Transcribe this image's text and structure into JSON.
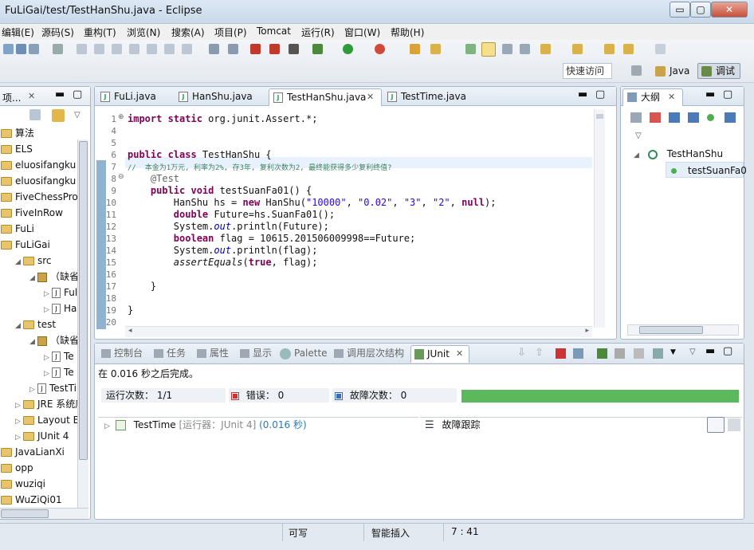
{
  "window": {
    "title": "FuLiGai/test/TestHanShu.java - Eclipse",
    "minimize": "▭",
    "maximize": "▢",
    "close": "✕"
  },
  "menu": [
    "编辑(E)",
    "源码(S)",
    "重构(T)",
    "浏览(N)",
    "搜索(A)",
    "项目(P)",
    "Tomcat",
    "运行(R)",
    "窗口(W)",
    "帮助(H)"
  ],
  "quick_access": "快速访问",
  "perspectives": {
    "java": "Java",
    "debug": "调试"
  },
  "explorer": {
    "tab": "项...",
    "items": [
      {
        "label": "算法",
        "indent": 0,
        "type": "project",
        "arrow": ""
      },
      {
        "label": "ELS",
        "indent": 0,
        "type": "project",
        "arrow": ""
      },
      {
        "label": "eluosifangku",
        "indent": 0,
        "type": "project",
        "arrow": ""
      },
      {
        "label": "eluosifangku",
        "indent": 0,
        "type": "project",
        "arrow": ""
      },
      {
        "label": "FiveChessPro",
        "indent": 0,
        "type": "project",
        "arrow": ""
      },
      {
        "label": "FiveInRow",
        "indent": 0,
        "type": "project",
        "arrow": ""
      },
      {
        "label": "FuLi",
        "indent": 0,
        "type": "project",
        "arrow": ""
      },
      {
        "label": "FuLiGai",
        "indent": 0,
        "type": "project",
        "arrow": ""
      },
      {
        "label": "src",
        "indent": 1,
        "type": "src",
        "arrow": "◢"
      },
      {
        "label": "（缺省",
        "indent": 2,
        "type": "pkg",
        "arrow": "◢"
      },
      {
        "label": "Ful",
        "indent": 3,
        "type": "java",
        "arrow": "▷"
      },
      {
        "label": "Ha",
        "indent": 3,
        "type": "java",
        "arrow": "▷"
      },
      {
        "label": "test",
        "indent": 1,
        "type": "src",
        "arrow": "◢"
      },
      {
        "label": "（缺省",
        "indent": 2,
        "type": "pkg",
        "arrow": "◢"
      },
      {
        "label": "Te",
        "indent": 3,
        "type": "java",
        "arrow": "▷"
      },
      {
        "label": "Te",
        "indent": 3,
        "type": "java",
        "arrow": "▷"
      },
      {
        "label": "TestTi",
        "indent": 2,
        "type": "java",
        "arrow": "▷"
      },
      {
        "label": "JRE 系统库",
        "indent": 1,
        "type": "lib",
        "arrow": "▷"
      },
      {
        "label": "Layout Ex",
        "indent": 1,
        "type": "lib",
        "arrow": "▷"
      },
      {
        "label": "JUnit 4",
        "indent": 1,
        "type": "lib",
        "arrow": "▷"
      },
      {
        "label": "JavaLianXi",
        "indent": 0,
        "type": "project",
        "arrow": ""
      },
      {
        "label": "opp",
        "indent": 0,
        "type": "project",
        "arrow": ""
      },
      {
        "label": "wuziqi",
        "indent": 0,
        "type": "project",
        "arrow": ""
      },
      {
        "label": "WuZiQi01",
        "indent": 0,
        "type": "project",
        "arrow": ""
      }
    ]
  },
  "editor": {
    "tabs": [
      {
        "label": "FuLi.java",
        "active": false
      },
      {
        "label": "HanShu.java",
        "active": false
      },
      {
        "label": "TestHanShu.java",
        "active": true
      },
      {
        "label": "TestTime.java",
        "active": false
      }
    ],
    "lines": [
      {
        "n": "1",
        "segs": [
          {
            "t": "import static",
            "c": "kw"
          },
          {
            "t": " org.junit.Assert.*;",
            "c": ""
          }
        ]
      },
      {
        "n": "4",
        "segs": []
      },
      {
        "n": "5",
        "segs": []
      },
      {
        "n": "6",
        "segs": [
          {
            "t": "public class",
            "c": "kw"
          },
          {
            "t": " TestHanShu {",
            "c": ""
          }
        ]
      },
      {
        "n": "7",
        "segs": [
          {
            "t": "//  ",
            "c": "cmt"
          },
          {
            "t": "本金为1万元, 利率为2%, 存3年, 复利次数为2, 最终能获得多少复利终值?",
            "c": "cmt"
          }
        ]
      },
      {
        "n": "8",
        "segs": [
          {
            "t": "    @Test",
            "c": "ann"
          }
        ]
      },
      {
        "n": "9",
        "segs": [
          {
            "t": "    ",
            "c": ""
          },
          {
            "t": "public void",
            "c": "kw"
          },
          {
            "t": " testSuanFa01() {",
            "c": ""
          }
        ]
      },
      {
        "n": "10",
        "segs": [
          {
            "t": "        HanShu hs = ",
            "c": ""
          },
          {
            "t": "new",
            "c": "kw"
          },
          {
            "t": " HanShu(",
            "c": ""
          },
          {
            "t": "\"10000\"",
            "c": "str"
          },
          {
            "t": ", ",
            "c": ""
          },
          {
            "t": "\"0.02\"",
            "c": "str"
          },
          {
            "t": ", ",
            "c": ""
          },
          {
            "t": "\"3\"",
            "c": "str"
          },
          {
            "t": ", ",
            "c": ""
          },
          {
            "t": "\"2\"",
            "c": "str"
          },
          {
            "t": ", ",
            "c": ""
          },
          {
            "t": "null",
            "c": "kw"
          },
          {
            "t": ");",
            "c": ""
          }
        ]
      },
      {
        "n": "11",
        "segs": [
          {
            "t": "        ",
            "c": ""
          },
          {
            "t": "double",
            "c": "kw"
          },
          {
            "t": " Future=hs.SuanFa01();",
            "c": ""
          }
        ]
      },
      {
        "n": "12",
        "segs": [
          {
            "t": "        System.",
            "c": ""
          },
          {
            "t": "out",
            "c": "fld"
          },
          {
            "t": ".println(Future);",
            "c": ""
          }
        ]
      },
      {
        "n": "13",
        "segs": [
          {
            "t": "        ",
            "c": ""
          },
          {
            "t": "boolean",
            "c": "kw"
          },
          {
            "t": " flag = 10615.201506009998==Future;",
            "c": ""
          }
        ]
      },
      {
        "n": "14",
        "segs": [
          {
            "t": "        System.",
            "c": ""
          },
          {
            "t": "out",
            "c": "fld"
          },
          {
            "t": ".println(flag);",
            "c": ""
          }
        ]
      },
      {
        "n": "15",
        "segs": [
          {
            "t": "        ",
            "c": ""
          },
          {
            "t": "assertEquals",
            "c": "ital"
          },
          {
            "t": "(",
            "c": ""
          },
          {
            "t": "true",
            "c": "kw"
          },
          {
            "t": ", flag);",
            "c": ""
          }
        ]
      },
      {
        "n": "16",
        "segs": []
      },
      {
        "n": "17",
        "segs": [
          {
            "t": "    }",
            "c": ""
          }
        ]
      },
      {
        "n": "18",
        "segs": []
      },
      {
        "n": "19",
        "segs": [
          {
            "t": "}",
            "c": ""
          }
        ]
      },
      {
        "n": "20",
        "segs": []
      }
    ]
  },
  "outline": {
    "tab": "大纲",
    "class_name": "TestHanShu",
    "method": "testSuanFa0"
  },
  "bottom": {
    "tabs": [
      "控制台",
      "任务",
      "属性",
      "显示",
      "Palette",
      "调用层次结构",
      "JUnit"
    ],
    "finished": "在 0.016 秒之后完成。",
    "runs_label": "运行次数：",
    "runs_value": "1/1",
    "errors_label": "错误：",
    "errors_value": "0",
    "failures_label": "故障次数：",
    "failures_value": "0",
    "progress": 1.0,
    "progress_color": "#5cb85c",
    "test_name": "TestTime",
    "test_runner": "[运行器：JUnit 4]",
    "test_time": "(0.016 秒)",
    "trace_label": "故障跟踪"
  },
  "status": {
    "writable": "可写",
    "insert": "智能插入",
    "position": "7 : 41"
  }
}
